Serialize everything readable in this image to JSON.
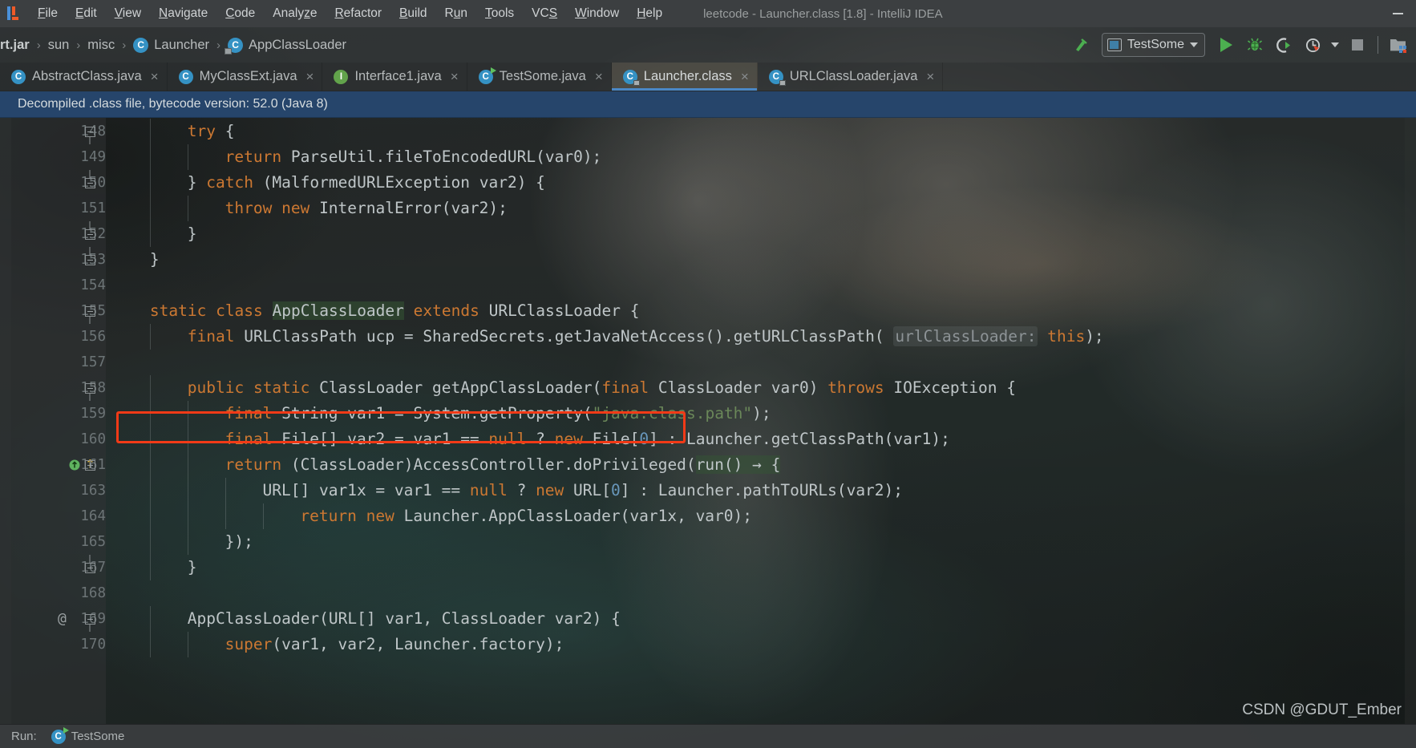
{
  "window": {
    "title": "leetcode - Launcher.class [1.8] - IntelliJ IDEA",
    "minimize_label": "—"
  },
  "menubar": {
    "items": [
      {
        "label": "File",
        "mnemonic": "F"
      },
      {
        "label": "Edit",
        "mnemonic": "E"
      },
      {
        "label": "View",
        "mnemonic": "V"
      },
      {
        "label": "Navigate",
        "mnemonic": "N"
      },
      {
        "label": "Code",
        "mnemonic": "C"
      },
      {
        "label": "Analyze",
        "mnemonic": "z"
      },
      {
        "label": "Refactor",
        "mnemonic": "R"
      },
      {
        "label": "Build",
        "mnemonic": "B"
      },
      {
        "label": "Run",
        "mnemonic": "u"
      },
      {
        "label": "Tools",
        "mnemonic": "T"
      },
      {
        "label": "VCS",
        "mnemonic": "S"
      },
      {
        "label": "Window",
        "mnemonic": "W"
      },
      {
        "label": "Help",
        "mnemonic": "H"
      }
    ]
  },
  "breadcrumb": {
    "items": [
      {
        "label": "rt.jar",
        "icon": "",
        "bold": true
      },
      {
        "label": "sun",
        "icon": ""
      },
      {
        "label": "misc",
        "icon": ""
      },
      {
        "label": "Launcher",
        "icon": "class-icon"
      },
      {
        "label": "AppClassLoader",
        "icon": "class-locked-icon"
      }
    ],
    "separator": "›"
  },
  "toolbar": {
    "build_icon": "hammer-icon",
    "run_config": "TestSome",
    "run_label": "Run",
    "debug_label": "Debug",
    "coverage_label": "Run with Coverage",
    "profiler_label": "Profiler",
    "stop_label": "Stop",
    "project_structure_label": "Project Structure",
    "accent_green": "#4caf50",
    "accent_red": "#f05a28"
  },
  "tabs": [
    {
      "label": "AbstractClass.java",
      "icon": "abstract-class-icon",
      "active": false,
      "closable": true
    },
    {
      "label": "MyClassExt.java",
      "icon": "class-icon",
      "active": false,
      "closable": true
    },
    {
      "label": "Interface1.java",
      "icon": "interface-icon",
      "active": false,
      "closable": true
    },
    {
      "label": "TestSome.java",
      "icon": "runnable-class-icon",
      "active": false,
      "closable": true
    },
    {
      "label": "Launcher.class",
      "icon": "class-locked-icon",
      "active": true,
      "closable": true
    },
    {
      "label": "URLClassLoader.java",
      "icon": "class-locked-icon",
      "active": false,
      "closable": true
    }
  ],
  "banner": {
    "text": "Decompiled .class file, bytecode version: 52.0 (Java 8)",
    "background": "#26456b"
  },
  "annotation": {
    "color": "#f23a17",
    "target_line": 155,
    "target_text": "static class AppClassLoader extends URLClassLoader {"
  },
  "editor": {
    "file": "Launcher.class",
    "lines": [
      {
        "num": "148",
        "fold": "start",
        "indent": 2,
        "text": "try {"
      },
      {
        "num": "149",
        "fold": "",
        "indent": 3,
        "text": "return ParseUtil.fileToEncodedURL(var0);"
      },
      {
        "num": "150",
        "fold": "end",
        "indent": 2,
        "text": "} catch (MalformedURLException var2) {"
      },
      {
        "num": "151",
        "fold": "",
        "indent": 3,
        "text": "throw new InternalError(var2);"
      },
      {
        "num": "152",
        "fold": "end",
        "indent": 2,
        "text": "}"
      },
      {
        "num": "153",
        "fold": "end",
        "indent": 1,
        "text": "}"
      },
      {
        "num": "154",
        "fold": "",
        "indent": 0,
        "text": ""
      },
      {
        "num": "155",
        "fold": "start",
        "indent": 1,
        "text": "static class AppClassLoader extends URLClassLoader {"
      },
      {
        "num": "156",
        "fold": "",
        "indent": 2,
        "text": "final URLClassPath ucp = SharedSecrets.getJavaNetAccess().getURLClassPath( urlClassLoader: this);"
      },
      {
        "num": "157",
        "fold": "",
        "indent": 0,
        "text": ""
      },
      {
        "num": "158",
        "fold": "start",
        "indent": 2,
        "text": "public static ClassLoader getAppClassLoader(final ClassLoader var0) throws IOException {"
      },
      {
        "num": "159",
        "fold": "",
        "indent": 3,
        "text": "final String var1 = System.getProperty(\"java.class.path\");"
      },
      {
        "num": "160",
        "fold": "",
        "indent": 3,
        "text": "final File[] var2 = var1 == null ? new File[0] : Launcher.getClassPath(var1);"
      },
      {
        "num": "161",
        "fold": "plus",
        "indent": 3,
        "text": "return (ClassLoader)AccessController.doPrivileged(run() -> {",
        "badge": "inspection-badge"
      },
      {
        "num": "163",
        "fold": "",
        "indent": 4,
        "text": "URL[] var1x = var1 == null ? new URL[0] : Launcher.pathToURLs(var2);"
      },
      {
        "num": "164",
        "fold": "",
        "indent": 5,
        "text": "return new Launcher.AppClassLoader(var1x, var0);"
      },
      {
        "num": "165",
        "fold": "",
        "indent": 3,
        "text": "});"
      },
      {
        "num": "167",
        "fold": "end",
        "indent": 2,
        "text": "}"
      },
      {
        "num": "168",
        "fold": "",
        "indent": 0,
        "text": ""
      },
      {
        "num": "169",
        "fold": "start",
        "indent": 2,
        "text": "AppClassLoader(URL[] var1, ClassLoader var2) {",
        "at_marker": "@"
      },
      {
        "num": "170",
        "fold": "",
        "indent": 3,
        "text": "super(var1, var2, Launcher.factory);"
      }
    ],
    "parameter_hint": "urlClassLoader:",
    "highlighted_identifier": "AppClassLoader",
    "colors": {
      "keyword": "#cc7832",
      "string": "#6a8759",
      "number": "#6897bb",
      "text": "#bfc6c8",
      "line_number": "#6c7476"
    }
  },
  "statusbar": {
    "run_label": "Run:",
    "run_config": "TestSome"
  },
  "watermark": {
    "text": "CSDN @GDUT_Ember"
  }
}
